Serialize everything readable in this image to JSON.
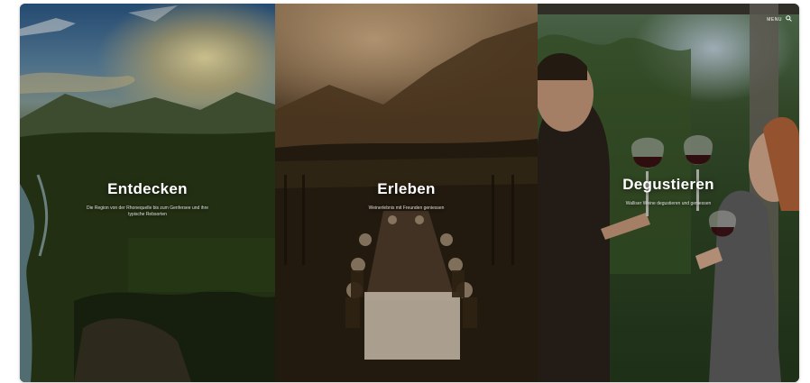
{
  "header": {
    "menu_label": "MENU",
    "search_icon": "search-icon"
  },
  "panels": [
    {
      "title": "Entdecken",
      "subtitle": "Die Region von der Rhonequelle bis zum Genfersee und ihre typische Rebsorten"
    },
    {
      "title": "Erleben",
      "subtitle": "Weinerlebnis mit Freunden geniessen"
    },
    {
      "title": "Degustieren",
      "subtitle": "Walliser Weine degustieren und geniessen"
    }
  ]
}
